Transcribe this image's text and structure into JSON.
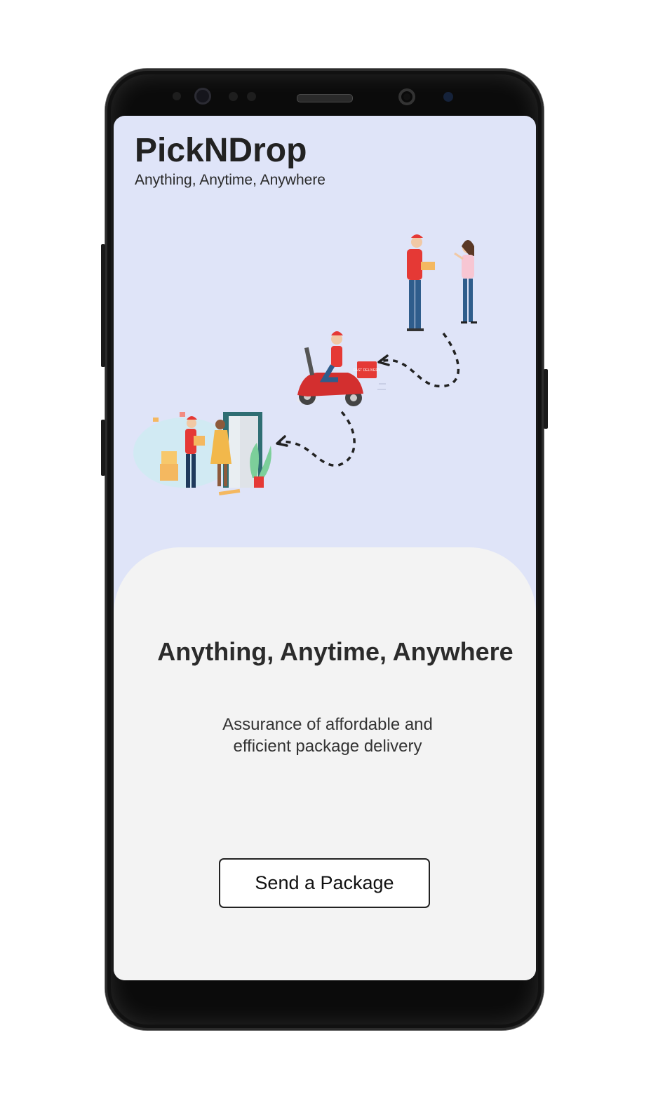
{
  "app": {
    "brand": "PickNDrop",
    "tagline": "Anything, Anytime, Anywhere"
  },
  "onboarding": {
    "title": "Anything, Anytime, Anywhere",
    "subtitle": "Assurance of affordable and efficient package delivery",
    "cta_label": "Send a Package"
  },
  "illustration": {
    "badge_text": "FAST DELIVERY"
  },
  "colors": {
    "screen_bg": "#dfe4f8",
    "card_bg": "#f3f3f3",
    "courier_red": "#e53935",
    "scooter_red": "#d32f2f",
    "denim": "#2f5d8c",
    "package": "#f4b860"
  }
}
